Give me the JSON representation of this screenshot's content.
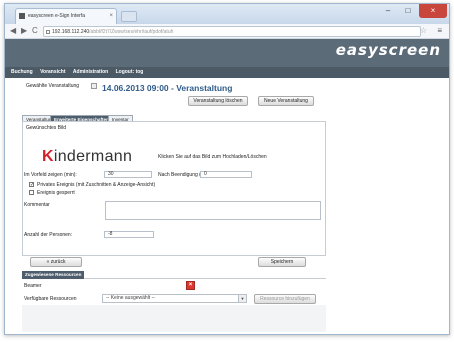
{
  "browser": {
    "tab_title": "easyscreen e-Sign Interfa",
    "tab_close": "×",
    "url_host": "192.168.112.240",
    "url_rest": "/abbl/f2t7/Zwsw/ses/ehri/auf/pdof/atuh",
    "back_icon": "◀",
    "forward_icon": "▶",
    "reload_icon": "C",
    "star_icon": "☆",
    "menu_icon": "≡",
    "minimize": "–",
    "maximize": "□",
    "close": "×"
  },
  "app": {
    "logo": "easyscreen",
    "nav": [
      "Buchung",
      "Voransicht",
      "Administration",
      "Logout: tog"
    ]
  },
  "event": {
    "select_label": "Gewählte Veranstaltung",
    "title": "14.06.2013 09:00 - Veranstaltung",
    "delete_button": "Veranstaltung löschen",
    "new_button": "Neue Veranstaltung"
  },
  "tabs": [
    "Veranstaltung",
    "Erweiterte Eigenschaften",
    "Inventar"
  ],
  "form": {
    "logo_label": "Gewünschtes Bild",
    "logo_text_k": "K",
    "logo_text_rest": "indermann",
    "logo_hint": "Klicken Sie auf das Bild zum Hochladen/Löschen",
    "before_label": "Im Vorfeld zeigen (min):",
    "before_value": "30",
    "after_label": "Nach Beendigung (min):",
    "after_value": "0",
    "private_label": "Privates Ereignis (mit Zuschnitten & Anzeige-Ansicht)",
    "locked_label": "Ereignis gesperrt",
    "comment_label": "Kommentar",
    "persons_label": "Anzahl der Personen:",
    "persons_value": "-8"
  },
  "actions": {
    "back_button": "« zurück",
    "save_button": "Speichern"
  },
  "resources": {
    "header": "Zugewiesene Ressourcen",
    "assigned_label": "Beamer",
    "delete_icon": "×",
    "available_label": "Verfügbare Ressourcen",
    "dropdown_value": "-- Keine ausgewählt --",
    "dropdown_arrow": "▼",
    "add_button": "Ressource hinzufügen"
  }
}
